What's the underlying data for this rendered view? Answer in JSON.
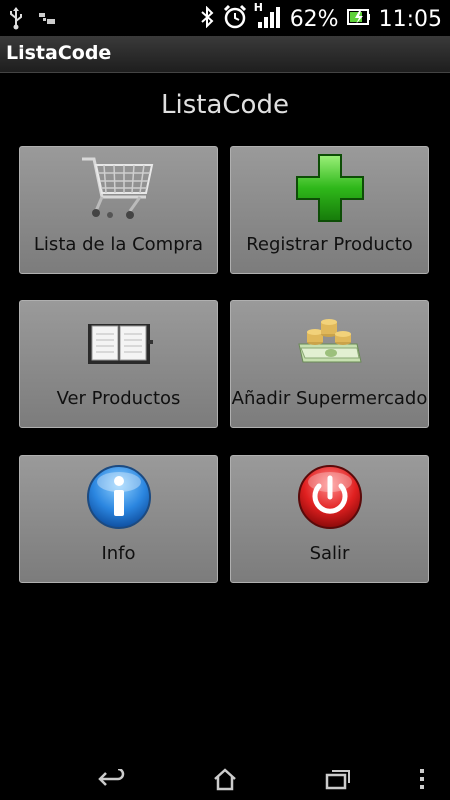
{
  "status_bar": {
    "battery": "62%",
    "time": "11:05",
    "network_type": "H",
    "icons": [
      "usb-icon",
      "sim-toolkit-icon",
      "bluetooth-icon",
      "alarm-icon",
      "signal-icon",
      "battery-icon"
    ]
  },
  "title_bar": {
    "title": "ListaCode"
  },
  "main": {
    "heading": "ListaCode",
    "tiles": [
      {
        "label": "Lista de la Compra",
        "icon": "shopping-cart-icon"
      },
      {
        "label": "Registrar Producto",
        "icon": "green-plus-icon"
      },
      {
        "label": "Ver Productos",
        "icon": "open-book-icon"
      },
      {
        "label": "Añadir Supermercado",
        "icon": "money-icon"
      },
      {
        "label": "Info",
        "icon": "info-icon"
      },
      {
        "label": "Salir",
        "icon": "power-icon"
      }
    ]
  },
  "nav_bar": {
    "buttons": [
      "back-icon",
      "home-icon",
      "recent-apps-icon",
      "menu-icon"
    ]
  },
  "colors": {
    "tile_bg": "#8c8c8c",
    "background": "#000000",
    "heading_text": "#e0e0e0"
  }
}
